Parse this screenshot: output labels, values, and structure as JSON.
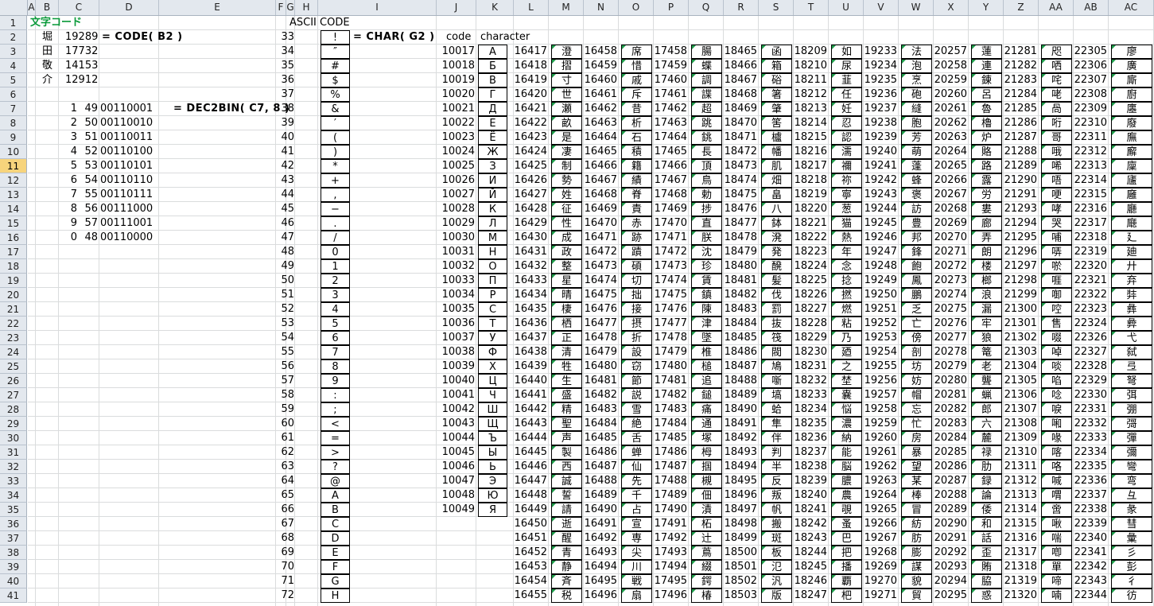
{
  "columns": [
    "A",
    "B",
    "C",
    "D",
    "E",
    "F",
    "G",
    "H",
    "I",
    "J",
    "K",
    "L",
    "M",
    "N",
    "O",
    "P",
    "Q",
    "R",
    "S",
    "T",
    "U",
    "V",
    "W",
    "X",
    "Y",
    "Z",
    "AA",
    "AB",
    "AC"
  ],
  "rows": [
    1,
    2,
    3,
    4,
    5,
    6,
    7,
    8,
    9,
    10,
    11,
    12,
    13,
    14,
    15,
    16,
    17,
    18,
    19,
    20,
    21,
    22,
    23,
    24,
    25,
    26,
    27,
    28,
    29,
    30,
    31,
    32,
    33,
    34,
    35,
    36,
    37,
    38,
    39,
    40,
    41
  ],
  "selected_row": 11,
  "left": {
    "title": "文字コード",
    "kanji": [
      [
        "堀",
        "19289"
      ],
      [
        "田",
        "17732"
      ],
      [
        "敬",
        "14153"
      ],
      [
        "介",
        "12912"
      ]
    ],
    "code_formula": "= CODE( B2 )",
    "bin_rows": [
      [
        "1",
        "49",
        "00110001"
      ],
      [
        "2",
        "50",
        "00110010"
      ],
      [
        "3",
        "51",
        "00110011"
      ],
      [
        "4",
        "52",
        "00110100"
      ],
      [
        "5",
        "53",
        "00110101"
      ],
      [
        "6",
        "54",
        "00110110"
      ],
      [
        "7",
        "55",
        "00110111"
      ],
      [
        "8",
        "56",
        "00111000"
      ],
      [
        "9",
        "57",
        "00111001"
      ],
      [
        "0",
        "48",
        "00110000"
      ]
    ],
    "bin_formula": "= DEC2BIN( C7, 8 )"
  },
  "ascii": {
    "title": "ASCII CODE",
    "formula": "= CHAR( G2 )",
    "rows": [
      [
        "33",
        "!"
      ],
      [
        "34",
        "″"
      ],
      [
        "35",
        "#"
      ],
      [
        "36",
        "$"
      ],
      [
        "37",
        "%"
      ],
      [
        "38",
        "&"
      ],
      [
        "39",
        "′"
      ],
      [
        "40",
        "("
      ],
      [
        "41",
        ")"
      ],
      [
        "42",
        "*"
      ],
      [
        "43",
        "+"
      ],
      [
        "44",
        ","
      ],
      [
        "45",
        "−"
      ],
      [
        "46",
        "."
      ],
      [
        "47",
        "/"
      ],
      [
        "48",
        "0"
      ],
      [
        "49",
        "1"
      ],
      [
        "50",
        "2"
      ],
      [
        "51",
        "3"
      ],
      [
        "52",
        "4"
      ],
      [
        "53",
        "5"
      ],
      [
        "54",
        "6"
      ],
      [
        "55",
        "7"
      ],
      [
        "56",
        "8"
      ],
      [
        "57",
        "9"
      ],
      [
        "58",
        ":"
      ],
      [
        "59",
        ";"
      ],
      [
        "60",
        "<"
      ],
      [
        "61",
        "="
      ],
      [
        "62",
        ">"
      ],
      [
        "63",
        "?"
      ],
      [
        "64",
        "@"
      ],
      [
        "65",
        "A"
      ],
      [
        "66",
        "B"
      ],
      [
        "67",
        "C"
      ],
      [
        "68",
        "D"
      ],
      [
        "69",
        "E"
      ],
      [
        "70",
        "F"
      ],
      [
        "71",
        "G"
      ],
      [
        "72",
        "H"
      ]
    ]
  },
  "cyr": {
    "code_label": "code",
    "char_label": "character",
    "rows": [
      [
        "10017",
        "А"
      ],
      [
        "10018",
        "Б"
      ],
      [
        "10019",
        "В"
      ],
      [
        "10020",
        "Г"
      ],
      [
        "10021",
        "Д"
      ],
      [
        "10022",
        "Е"
      ],
      [
        "10023",
        "Ё"
      ],
      [
        "10024",
        "Ж"
      ],
      [
        "10025",
        "З"
      ],
      [
        "10026",
        "И"
      ],
      [
        "10027",
        "Й"
      ],
      [
        "10028",
        "К"
      ],
      [
        "10029",
        "Л"
      ],
      [
        "10030",
        "М"
      ],
      [
        "10031",
        "Н"
      ],
      [
        "10032",
        "О"
      ],
      [
        "10033",
        "П"
      ],
      [
        "10034",
        "Р"
      ],
      [
        "10035",
        "С"
      ],
      [
        "10036",
        "Т"
      ],
      [
        "10037",
        "У"
      ],
      [
        "10038",
        "Ф"
      ],
      [
        "10039",
        "Х"
      ],
      [
        "10040",
        "Ц"
      ],
      [
        "10041",
        "Ч"
      ],
      [
        "10042",
        "Ш"
      ],
      [
        "10043",
        "Щ"
      ],
      [
        "10044",
        "Ъ"
      ],
      [
        "10045",
        "Ы"
      ],
      [
        "10046",
        "Ь"
      ],
      [
        "10047",
        "Э"
      ],
      [
        "10048",
        "Ю"
      ],
      [
        "10049",
        "Я"
      ]
    ]
  },
  "kanji_cols": [
    {
      "codes": [
        "16417",
        "16418",
        "16419",
        "16420",
        "16421",
        "16422",
        "16423",
        "16424",
        "16425",
        "16426",
        "16427",
        "16428",
        "16429",
        "16430",
        "16431",
        "16432",
        "16433",
        "16434",
        "16435",
        "16436",
        "16437",
        "16438",
        "16439",
        "16440",
        "16441",
        "16442",
        "16443",
        "16444",
        "16445",
        "16446",
        "16447",
        "16448",
        "16449",
        "16450",
        "16451",
        "16452",
        "16453",
        "16454",
        "16455"
      ],
      "chars": [
        "澄",
        "摺",
        "寸",
        "世",
        "瀬",
        "畝",
        "是",
        "凄",
        "制",
        "勢",
        "姓",
        "征",
        "性",
        "成",
        "政",
        "整",
        "星",
        "晴",
        "棲",
        "栖",
        "正",
        "清",
        "牲",
        "生",
        "盛",
        "精",
        "聖",
        "声",
        "製",
        "西",
        "誠",
        "誓",
        "請",
        "逝",
        "醒",
        "青",
        "静",
        "斉",
        "税"
      ]
    },
    {
      "codes": [
        "16458",
        "16459",
        "16460",
        "16461",
        "16462",
        "16463",
        "16464",
        "16465",
        "16466",
        "16467",
        "16468",
        "16469",
        "16470",
        "16471",
        "16472",
        "16473",
        "16474",
        "16475",
        "16476",
        "16477",
        "16478",
        "16479",
        "16480",
        "16481",
        "16482",
        "16483",
        "16484",
        "16485",
        "16486",
        "16487",
        "16488",
        "16489",
        "16490",
        "16491",
        "16492",
        "16493",
        "16494",
        "16495",
        "16496"
      ],
      "chars": [
        "席",
        "惜",
        "戚",
        "斥",
        "昔",
        "析",
        "石",
        "積",
        "籍",
        "績",
        "脊",
        "責",
        "赤",
        "跡",
        "蹟",
        "碩",
        "切",
        "拙",
        "接",
        "摂",
        "折",
        "設",
        "窃",
        "節",
        "説",
        "雪",
        "絶",
        "舌",
        "蝉",
        "仙",
        "先",
        "千",
        "占",
        "宣",
        "専",
        "尖",
        "川",
        "戦",
        "扇"
      ]
    },
    {
      "codes": [
        "17458",
        "17459",
        "17460",
        "17461",
        "17462",
        "17463",
        "17464",
        "17465",
        "17466",
        "17467",
        "17468",
        "17469",
        "17470",
        "17471",
        "17472",
        "17473",
        "17474",
        "17475",
        "17476",
        "17477",
        "17478",
        "17479",
        "17480",
        "17481",
        "17482",
        "17483",
        "17484",
        "17485",
        "17486",
        "17487",
        "17488",
        "17489",
        "17490",
        "17491",
        "17492",
        "17493",
        "17494",
        "17495",
        "17496"
      ],
      "chars": [
        "腸",
        "蝶",
        "調",
        "諜",
        "超",
        "跳",
        "銚",
        "長",
        "頂",
        "鳥",
        "勅",
        "捗",
        "直",
        "朕",
        "沈",
        "珍",
        "賃",
        "鎮",
        "陳",
        "津",
        "墜",
        "椎",
        "槌",
        "追",
        "鎚",
        "痛",
        "通",
        "塚",
        "栂",
        "掴",
        "槻",
        "佃",
        "漬",
        "柘",
        "辻",
        "蔦",
        "綴",
        "鍔",
        "椿"
      ]
    },
    {
      "codes": [
        "18465",
        "18466",
        "18467",
        "18468",
        "18469",
        "18470",
        "18471",
        "18472",
        "18473",
        "18474",
        "18475",
        "18476",
        "18477",
        "18478",
        "18479",
        "18480",
        "18481",
        "18482",
        "18483",
        "18484",
        "18485",
        "18486",
        "18487",
        "18488",
        "18489",
        "18490",
        "18491",
        "18492",
        "18493",
        "18494",
        "18495",
        "18496",
        "18497",
        "18498",
        "18499",
        "18500",
        "18501",
        "18502",
        "18503"
      ],
      "chars": [
        "函",
        "箱",
        "硲",
        "箸",
        "肇",
        "筈",
        "櫨",
        "幡",
        "肌",
        "畑",
        "畠",
        "八",
        "鉢",
        "溌",
        "発",
        "醗",
        "髪",
        "伐",
        "罰",
        "抜",
        "筏",
        "閥",
        "鳩",
        "噺",
        "塙",
        "蛤",
        "隼",
        "伴",
        "判",
        "半",
        "反",
        "叛",
        "帆",
        "搬",
        "斑",
        "板",
        "氾",
        "汎",
        "版"
      ]
    },
    {
      "codes": [
        "18209",
        "18210",
        "18211",
        "18212",
        "18213",
        "18214",
        "18215",
        "18216",
        "18217",
        "18218",
        "18219",
        "18220",
        "18221",
        "18222",
        "18223",
        "18224",
        "18225",
        "18226",
        "18227",
        "18228",
        "18229",
        "18230",
        "18231",
        "18232",
        "18233",
        "18234",
        "18235",
        "18236",
        "18237",
        "18238",
        "18239",
        "18240",
        "18241",
        "18242",
        "18243",
        "18244",
        "18245",
        "18246",
        "18247"
      ],
      "chars": [
        "如",
        "尿",
        "韮",
        "任",
        "妊",
        "忍",
        "認",
        "濡",
        "禰",
        "祢",
        "寧",
        "葱",
        "猫",
        "熱",
        "年",
        "念",
        "捻",
        "撚",
        "燃",
        "粘",
        "乃",
        "廼",
        "之",
        "埜",
        "嚢",
        "悩",
        "濃",
        "納",
        "能",
        "脳",
        "膿",
        "農",
        "覗",
        "蚤",
        "巴",
        "把",
        "播",
        "覇",
        "杷"
      ]
    },
    {
      "codes": [
        "19233",
        "19234",
        "19235",
        "19236",
        "19237",
        "19238",
        "19239",
        "19240",
        "19241",
        "19242",
        "19243",
        "19244",
        "19245",
        "19246",
        "19247",
        "19248",
        "19249",
        "19250",
        "19251",
        "19252",
        "19253",
        "19254",
        "19255",
        "19256",
        "19257",
        "19258",
        "19259",
        "19260",
        "19261",
        "19262",
        "19263",
        "19264",
        "19265",
        "19266",
        "19267",
        "19268",
        "19269",
        "19270",
        "19271"
      ],
      "chars": [
        "法",
        "泡",
        "烹",
        "砲",
        "縫",
        "胞",
        "芳",
        "萌",
        "蓬",
        "蜂",
        "褒",
        "訪",
        "豊",
        "邦",
        "鋒",
        "飽",
        "鳳",
        "鵬",
        "乏",
        "亡",
        "傍",
        "剖",
        "坊",
        "妨",
        "帽",
        "忘",
        "忙",
        "房",
        "暴",
        "望",
        "某",
        "棒",
        "冒",
        "紡",
        "肪",
        "膨",
        "謀",
        "貌",
        "貿"
      ]
    },
    {
      "codes": [
        "20257",
        "20258",
        "20259",
        "20260",
        "20261",
        "20262",
        "20263",
        "20264",
        "20265",
        "20266",
        "20267",
        "20268",
        "20269",
        "20270",
        "20271",
        "20272",
        "20273",
        "20274",
        "20275",
        "20276",
        "20277",
        "20278",
        "20279",
        "20280",
        "20281",
        "20282",
        "20283",
        "20284",
        "20285",
        "20286",
        "20287",
        "20288",
        "20289",
        "20290",
        "20291",
        "20292",
        "20293",
        "20294",
        "20295"
      ],
      "chars": [
        "蓮",
        "連",
        "錬",
        "呂",
        "魯",
        "櫓",
        "炉",
        "賂",
        "路",
        "露",
        "労",
        "婁",
        "廊",
        "弄",
        "朗",
        "楼",
        "榔",
        "浪",
        "漏",
        "牢",
        "狼",
        "篭",
        "老",
        "聾",
        "蝋",
        "郎",
        "六",
        "麓",
        "禄",
        "肋",
        "録",
        "論",
        "倭",
        "和",
        "話",
        "歪",
        "賄",
        "脇",
        "惑"
      ]
    },
    {
      "codes": [
        "21281",
        "21282",
        "21283",
        "21284",
        "21285",
        "21286",
        "21287",
        "21288",
        "21289",
        "21290",
        "21291",
        "21293",
        "21294",
        "21295",
        "21296",
        "21297",
        "21298",
        "21299",
        "21300",
        "21301",
        "21302",
        "21303",
        "21304",
        "21305",
        "21306",
        "21307",
        "21308",
        "21309",
        "21310",
        "21311",
        "21312",
        "21313",
        "21314",
        "21315",
        "21316",
        "21317",
        "21318",
        "21319",
        "21320"
      ],
      "chars": [
        "咫",
        "哂",
        "咤",
        "咾",
        "咼",
        "哘",
        "哥",
        "哦",
        "唏",
        "唔",
        "哽",
        "哮",
        "哭",
        "哺",
        "哢",
        "唹",
        "啀",
        "啣",
        "啌",
        "售",
        "啜",
        "啅",
        "啖",
        "啗",
        "唸",
        "唳",
        "啝",
        "喙",
        "喀",
        "咯",
        "喊",
        "喟",
        "啻",
        "啾",
        "喘",
        "喞",
        "單",
        "啼",
        "喃"
      ]
    },
    {
      "codes": [
        "22305",
        "22306",
        "22307",
        "22308",
        "22309",
        "22310",
        "22311",
        "22312",
        "22313",
        "22314",
        "22315",
        "22316",
        "22317",
        "22318",
        "22319",
        "22320",
        "22321",
        "22322",
        "22323",
        "22324",
        "22326",
        "22327",
        "22328",
        "22329",
        "22330",
        "22331",
        "22332",
        "22333",
        "22334",
        "22335",
        "22336",
        "22337",
        "22338",
        "22339",
        "22340",
        "22341",
        "22342",
        "22343",
        "22344"
      ],
      "chars": [
        "廖",
        "廣",
        "廝",
        "廚",
        "廛",
        "廢",
        "廡",
        "廨",
        "廩",
        "廬",
        "廱",
        "廳",
        "廰",
        "廴",
        "廸",
        "廾",
        "弃",
        "弉",
        "彝",
        "彜",
        "弋",
        "弑",
        "弖",
        "弩",
        "弭",
        "弸",
        "彁",
        "彈",
        "彌",
        "彎",
        "弯",
        "彑",
        "彖",
        "彗",
        "彙",
        "彡",
        "彭",
        "彳",
        "彷"
      ]
    }
  ]
}
